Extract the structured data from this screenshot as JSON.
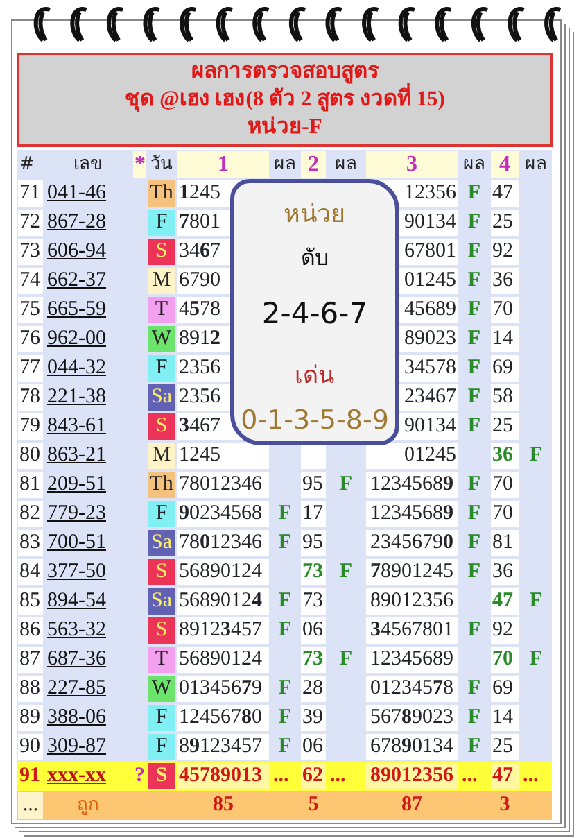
{
  "title_lines": [
    "ผลการตรวจสอบสูตร",
    "ชุด @เฮง เฮง(8 ตัว 2 สูตร งวดที่ 15)",
    "หน่วย-F"
  ],
  "columns": [
    {
      "label": "#",
      "kind": "plain"
    },
    {
      "label": "เลข",
      "kind": "plain"
    },
    {
      "label": "*",
      "kind": "accent"
    },
    {
      "label": "วัน",
      "kind": "plain"
    },
    {
      "label": "1",
      "kind": "accent"
    },
    {
      "label": "ผล",
      "kind": "plain"
    },
    {
      "label": "2",
      "kind": "accent"
    },
    {
      "label": "ผล",
      "kind": "plain"
    },
    {
      "label": "3",
      "kind": "accent"
    },
    {
      "label": "ผล",
      "kind": "plain"
    },
    {
      "label": "4",
      "kind": "accent"
    },
    {
      "label": "ผล",
      "kind": "plain"
    }
  ],
  "rows": [
    {
      "kind": "result",
      "no": "71",
      "number": "041-46",
      "day": "Th",
      "color": "#f4c27c",
      "r1": "**1**245",
      "r3": "12356",
      "f3": "F",
      "r4": "47",
      "r4_hit": false
    },
    {
      "kind": "result",
      "no": "72",
      "number": "867-28",
      "day": "F",
      "color": "#80f0f4",
      "r1": "**7**801",
      "r3": "90134",
      "f3": "F",
      "r4": "25",
      "r4_hit": false
    },
    {
      "kind": "result",
      "no": "73",
      "number": "606-94",
      "day": "S",
      "color": "#ec3458",
      "r1": "34**6**7",
      "r3": "67801",
      "f3": "F",
      "r4": "92",
      "r4_hit": false
    },
    {
      "kind": "result",
      "no": "74",
      "number": "662-37",
      "day": "M",
      "color": "#fff4c8",
      "r1": "6790",
      "r3": "01245",
      "f3": "F",
      "r4": "36",
      "r4_hit": false
    },
    {
      "kind": "result",
      "no": "75",
      "number": "665-59",
      "day": "T",
      "color": "#f4a0f0",
      "r1": "4**5**78",
      "r3": "45689",
      "f3": "F",
      "r4": "70",
      "r4_hit": false
    },
    {
      "kind": "result",
      "no": "76",
      "number": "962-00",
      "day": "W",
      "color": "#6ce46c",
      "r1": "891**2**",
      "r3": "89023",
      "f3": "F",
      "r4": "14",
      "r4_hit": false
    },
    {
      "kind": "result",
      "no": "77",
      "number": "044-32",
      "day": "F",
      "color": "#80f0f4",
      "r1": "2356",
      "r3": "34578",
      "f3": "F",
      "r4": "69",
      "r4_hit": false
    },
    {
      "kind": "result",
      "no": "78",
      "number": "221-38",
      "day": "Sa",
      "color": "#6262b4",
      "r1": "2356",
      "r3": "23467",
      "f3": "F",
      "r4": "58",
      "r4_hit": false
    },
    {
      "kind": "result",
      "no": "79",
      "number": "843-61",
      "day": "S",
      "color": "#ec3458",
      "r1": "**3**467",
      "r3": "90134",
      "f3": "F",
      "r4": "25",
      "r4_hit": false
    },
    {
      "kind": "result",
      "no": "80",
      "number": "863-21",
      "day": "M",
      "color": "#fff4c8",
      "r1": "1245",
      "r3": "01245",
      "r4": "36",
      "r4_hit": true,
      "f4": "F"
    },
    {
      "kind": "result",
      "no": "81",
      "number": "209-51",
      "day": "Th",
      "color": "#f4c27c",
      "r1": "78012346",
      "r2": "95",
      "r2_hit": false,
      "f2": "F",
      "r3": "1234568**9**",
      "f3": "F",
      "r4": "70",
      "r4_hit": false
    },
    {
      "kind": "result",
      "no": "82",
      "number": "779-23",
      "day": "F",
      "color": "#80f0f4",
      "r1": "**9**0234568",
      "f1": "F",
      "r2": "17",
      "r2_hit": false,
      "r3": "1234568**9**",
      "f3": "F",
      "r4": "70",
      "r4_hit": false
    },
    {
      "kind": "result",
      "no": "83",
      "number": "700-51",
      "day": "Sa",
      "color": "#6262b4",
      "r1": "78**0**12346",
      "f1": "F",
      "r2": "95",
      "r2_hit": false,
      "r3": "2345679**0**",
      "f3": "F",
      "r4": "81",
      "r4_hit": false
    },
    {
      "kind": "result",
      "no": "84",
      "number": "377-50",
      "day": "S",
      "color": "#ec3458",
      "r1": "56890124",
      "r2": "73",
      "r2_hit": true,
      "f2": "F",
      "r3": "**7**8901245",
      "f3": "F",
      "r4": "36",
      "r4_hit": false
    },
    {
      "kind": "result",
      "no": "85",
      "number": "894-54",
      "day": "Sa",
      "color": "#6262b4",
      "r1": "5689012**4**",
      "f1": "F",
      "r2": "73",
      "r2_hit": false,
      "r3": "89012356",
      "r4": "47",
      "r4_hit": true,
      "f4": "F"
    },
    {
      "kind": "result",
      "no": "86",
      "number": "563-32",
      "day": "S",
      "color": "#ec3458",
      "r1": "8912**3**457",
      "f1": "F",
      "r2": "06",
      "r2_hit": false,
      "r3": "**3**4567801",
      "f3": "F",
      "r4": "92",
      "r4_hit": false
    },
    {
      "kind": "result",
      "no": "87",
      "number": "687-36",
      "day": "T",
      "color": "#f4a0f0",
      "r1": "56890124",
      "r2": "73",
      "r2_hit": true,
      "f2": "F",
      "r3": "12345689",
      "r4": "70",
      "r4_hit": true,
      "f4": "F"
    },
    {
      "kind": "result",
      "no": "88",
      "number": "227-85",
      "day": "W",
      "color": "#6ce46c",
      "r1": "013456**7**9",
      "f1": "F",
      "r2": "28",
      "r2_hit": false,
      "r3": "012345**7**8",
      "f3": "F",
      "r4": "69",
      "r4_hit": false
    },
    {
      "kind": "result",
      "no": "89",
      "number": "388-06",
      "day": "F",
      "color": "#80f0f4",
      "r1": "124567**8**0",
      "f1": "F",
      "r2": "39",
      "r2_hit": false,
      "r3": "567**8**9023",
      "f3": "F",
      "r4": "14",
      "r4_hit": false
    },
    {
      "kind": "result",
      "no": "90",
      "number": "309-87",
      "day": "F",
      "color": "#80f0f4",
      "r1": "8**9**123457",
      "f1": "F",
      "r2": "06",
      "r2_hit": false,
      "r3": "678**9**0134",
      "f3": "F",
      "r4": "25",
      "r4_hit": false
    },
    {
      "kind": "current",
      "no": "91",
      "number": "xxx-xx",
      "mark": "?",
      "day": "S",
      "color": "#ec3458",
      "r1": "45789013",
      "f1": "...",
      "r2": "62",
      "f2": "...",
      "r3": "89012356",
      "f3": "...",
      "r4": "47",
      "f4": "..."
    }
  ],
  "totals": {
    "first": "...",
    "label": "ถูก",
    "t1": "85",
    "t2": "5",
    "t3": "87",
    "t4": "3"
  },
  "popup": {
    "unit_label": "หน่วย",
    "off_label": "ดับ",
    "off_digits": "2-4-6-7",
    "strong_label": "เด่น",
    "strong_digits": "0-1-3-5-8-9"
  }
}
